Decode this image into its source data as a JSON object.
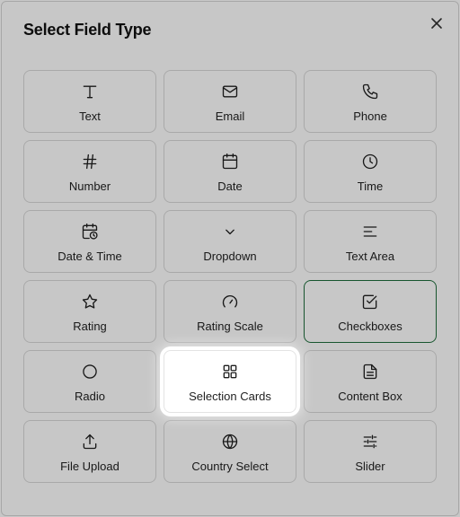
{
  "dialog": {
    "title": "Select Field Type",
    "close_icon": "close-icon"
  },
  "field_types": [
    {
      "label": "Text",
      "icon": "text-icon"
    },
    {
      "label": "Email",
      "icon": "mail-icon"
    },
    {
      "label": "Phone",
      "icon": "phone-icon"
    },
    {
      "label": "Number",
      "icon": "hash-icon"
    },
    {
      "label": "Date",
      "icon": "calendar-icon"
    },
    {
      "label": "Time",
      "icon": "clock-icon"
    },
    {
      "label": "Date & Time",
      "icon": "calendar-clock-icon"
    },
    {
      "label": "Dropdown",
      "icon": "chevron-down-icon"
    },
    {
      "label": "Text Area",
      "icon": "align-left-icon"
    },
    {
      "label": "Rating",
      "icon": "star-icon"
    },
    {
      "label": "Rating Scale",
      "icon": "gauge-icon"
    },
    {
      "label": "Checkboxes",
      "icon": "check-square-icon"
    },
    {
      "label": "Radio",
      "icon": "circle-icon"
    },
    {
      "label": "Selection Cards",
      "icon": "grid-icon"
    },
    {
      "label": "Content Box",
      "icon": "file-text-icon"
    },
    {
      "label": "File Upload",
      "icon": "upload-icon"
    },
    {
      "label": "Country Select",
      "icon": "globe-icon"
    },
    {
      "label": "Slider",
      "icon": "sliders-icon"
    }
  ],
  "state": {
    "selected": "Checkboxes",
    "highlighted": "Selection Cards"
  },
  "colors": {
    "selected_border": "#1e6e3c",
    "overlay": "rgba(0,0,0,0.22)"
  }
}
